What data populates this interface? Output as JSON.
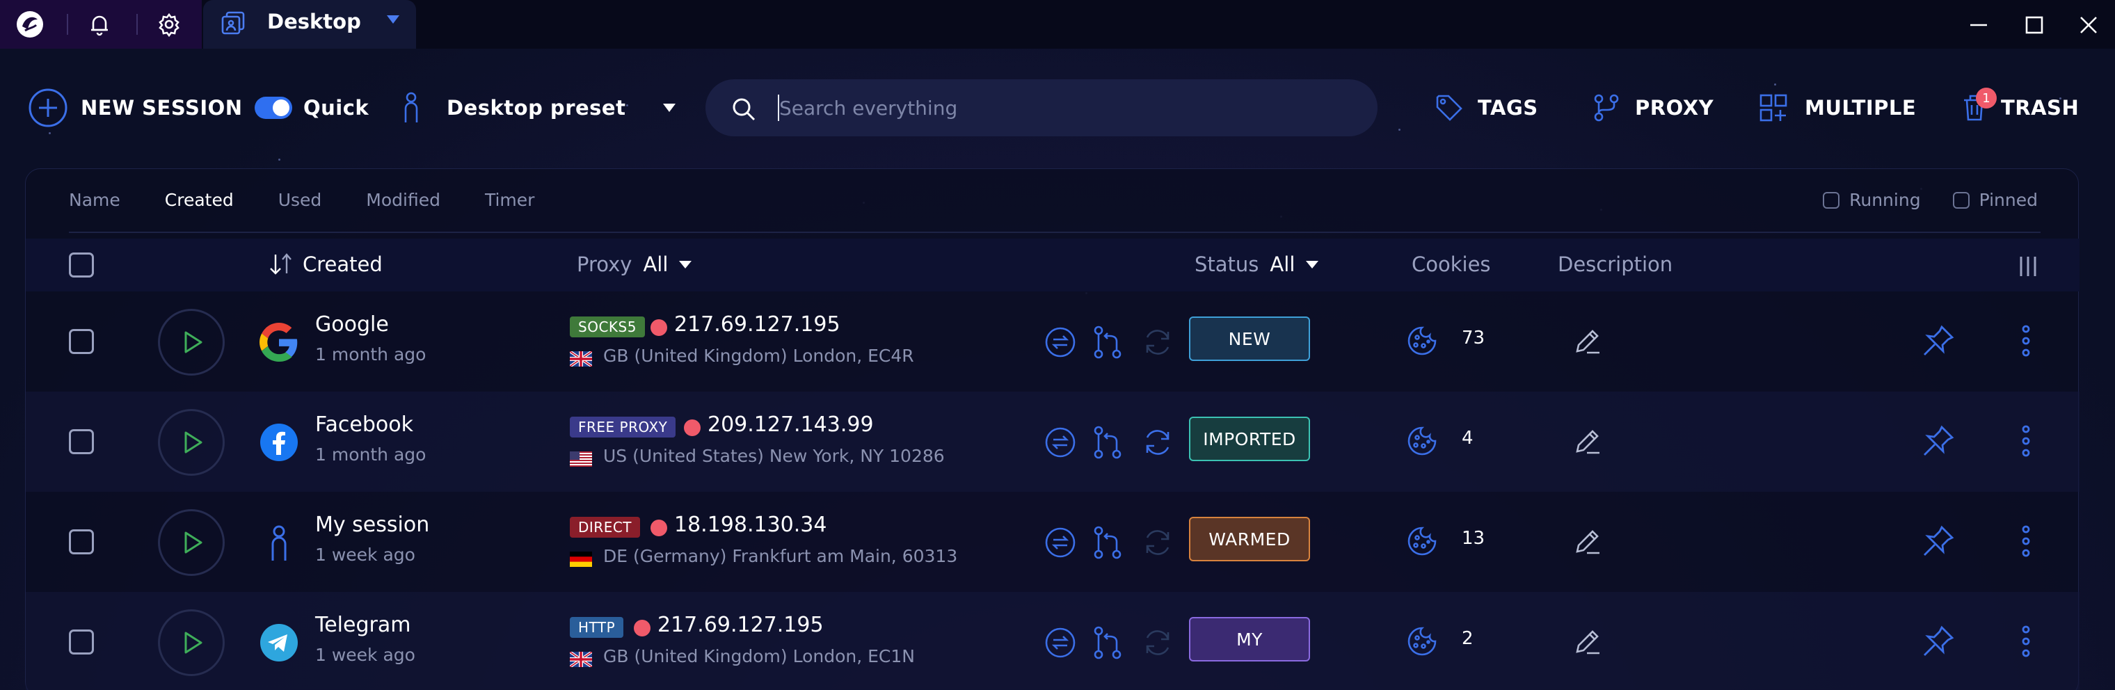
{
  "titlebar": {
    "tab_label": "Desktop"
  },
  "toolbar": {
    "new_session": "NEW SESSION",
    "quick_label": "Quick",
    "quick_enabled": true,
    "preset_label": "Desktop preset",
    "search_placeholder": "Search everything",
    "tags": "TAGS",
    "proxy": "PROXY",
    "multiple": "MULTIPLE",
    "trash": "TRASH",
    "trash_count": "1"
  },
  "sort_tabs": [
    "Name",
    "Created",
    "Used",
    "Modified",
    "Timer"
  ],
  "active_sort": "Created",
  "filters": {
    "running": "Running",
    "pinned": "Pinned"
  },
  "columns": {
    "created": "Created",
    "proxy": "Proxy",
    "proxy_filter": "All",
    "status": "Status",
    "status_filter": "All",
    "cookies": "Cookies",
    "description": "Description"
  },
  "sessions": [
    {
      "name": "Google",
      "age": "1 month ago",
      "logo": "google-logo",
      "proxy_type": "SOCKS5",
      "proxy_type_color": "#3f7a3a",
      "ip": "217.69.127.195",
      "flag": "uk-flag",
      "location": "GB (United Kingdom) London, EC4R",
      "status": "NEW",
      "status_bg": "#18334f",
      "status_border": "#3fa0d8",
      "cookies": "73"
    },
    {
      "name": "Facebook",
      "age": "1 month ago",
      "logo": "facebook-logo",
      "proxy_type": "FREE PROXY",
      "proxy_type_color": "#3a3a8a",
      "ip": "209.127.143.99",
      "flag": "us-flag",
      "location": "US (United States) New York, NY 10286",
      "status": "IMPORTED",
      "status_bg": "#173d3f",
      "status_border": "#3cc2b3",
      "cookies": "4"
    },
    {
      "name": "My session",
      "age": "1 week ago",
      "logo": "person-icon",
      "proxy_type": "DIRECT",
      "proxy_type_color": "#8a1e2a",
      "ip": "18.198.130.34",
      "flag": "de-flag",
      "location": "DE (Germany) Frankfurt am Main, 60313",
      "status": "WARMED",
      "status_bg": "#5a3526",
      "status_border": "#d8833e",
      "cookies": "13"
    },
    {
      "name": "Telegram",
      "age": "1 week ago",
      "logo": "telegram-logo",
      "proxy_type": "HTTP",
      "proxy_type_color": "#2a5e9a",
      "ip": "217.69.127.195",
      "flag": "uk-flag",
      "location": "GB (United Kingdom) London, EC1N",
      "status": "MY",
      "status_bg": "#3b2a72",
      "status_border": "#8a6ae0",
      "cookies": "2"
    }
  ],
  "colors": {
    "accent": "#2f6ff0",
    "icon_blue": "#3b6fe8",
    "play_green": "#3fae5a",
    "title_left": "#1b0a3a"
  }
}
